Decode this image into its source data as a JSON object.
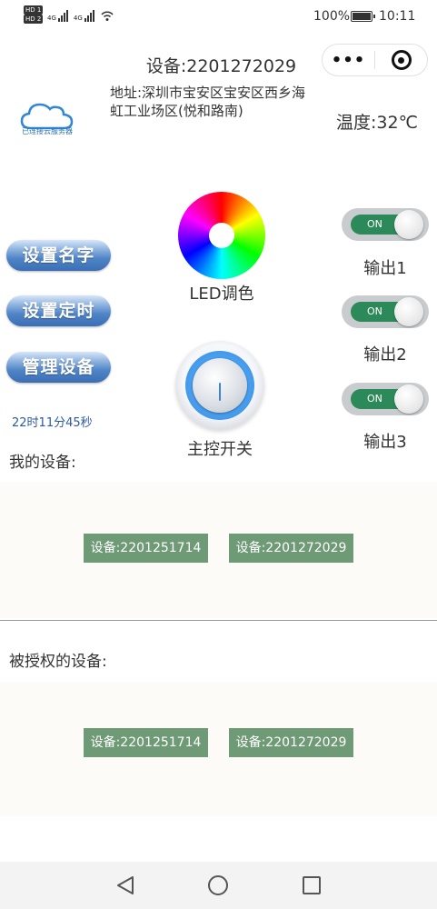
{
  "status_bar": {
    "sim1": "HD 1",
    "sim2": "HD 2",
    "network": "4G",
    "battery": "100%",
    "time": "10:11",
    "icons": [
      "signal-icon",
      "signal-icon",
      "wifi-icon",
      "battery-icon"
    ]
  },
  "capsule": {
    "more_icon": "more-dots-icon",
    "close_icon": "target-close-icon"
  },
  "header": {
    "title": "设备:2201272029",
    "cloud_status": "已连接云服务器",
    "address": "地址:深圳市宝安区宝安区西乡海虹工业场区(悦和路南)",
    "temperature": "温度:32℃"
  },
  "controls": {
    "buttons": [
      "设置名字",
      "设置定时",
      "管理设备"
    ],
    "timer": "22时11分45秒",
    "led_label": "LED调色",
    "main_switch_label": "主控开关"
  },
  "outputs": [
    {
      "label": "输出1",
      "state": "ON",
      "on": true
    },
    {
      "label": "输出2",
      "state": "ON",
      "on": true
    },
    {
      "label": "输出3",
      "state": "ON",
      "on": true
    }
  ],
  "my_devices": {
    "title": "我的设备:",
    "items": [
      "设备:2201251714",
      "设备:2201272029"
    ]
  },
  "authorized_devices": {
    "title": "被授权的设备:",
    "items": [
      "设备:2201251714",
      "设备:2201272029"
    ]
  },
  "colors": {
    "pill_blue": "#4f84c6",
    "toggle_green": "#2c8a5a",
    "device_button": "#6e9a76",
    "timer_text": "#2c5aa0"
  }
}
